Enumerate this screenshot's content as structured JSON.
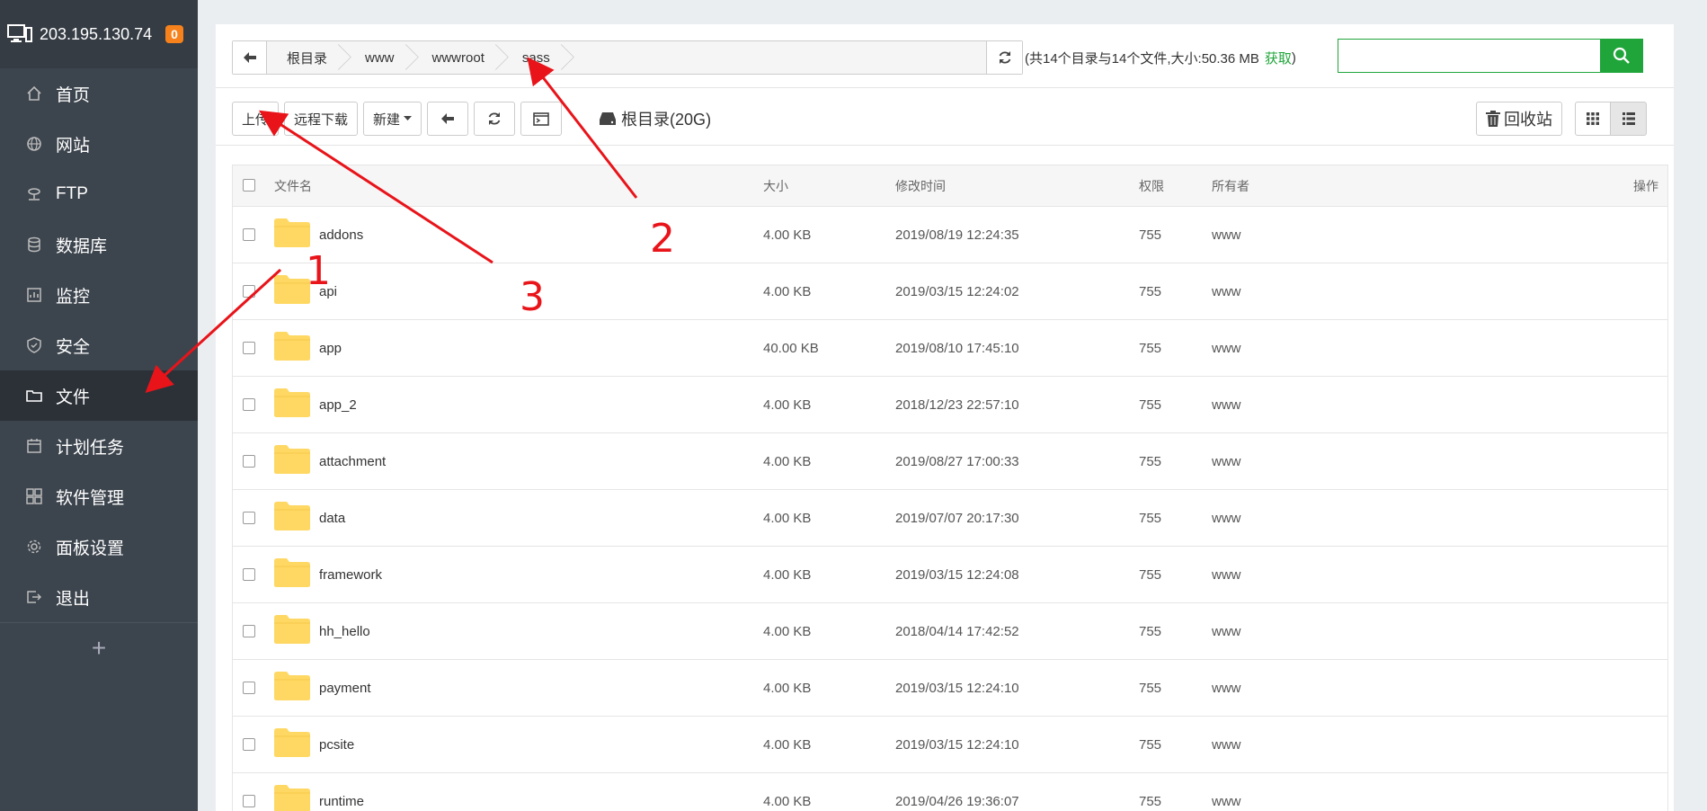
{
  "sidebar": {
    "ip": "203.195.130.74",
    "badge": "0",
    "items": [
      {
        "label": "首页",
        "icon": "home-icon"
      },
      {
        "label": "网站",
        "icon": "globe-icon"
      },
      {
        "label": "FTP",
        "icon": "ftp-icon"
      },
      {
        "label": "数据库",
        "icon": "database-icon"
      },
      {
        "label": "监控",
        "icon": "monitor-icon"
      },
      {
        "label": "安全",
        "icon": "shield-icon"
      },
      {
        "label": "文件",
        "icon": "folder-icon"
      },
      {
        "label": "计划任务",
        "icon": "calendar-icon"
      },
      {
        "label": "软件管理",
        "icon": "apps-icon"
      },
      {
        "label": "面板设置",
        "icon": "gear-icon"
      },
      {
        "label": "退出",
        "icon": "logout-icon"
      }
    ],
    "add": "+"
  },
  "pathbar": {
    "crumbs": [
      "根目录",
      "www",
      "wwwroot",
      "sass"
    ]
  },
  "summary": {
    "text": "(共14个目录与14个文件,大小:50.36 MB",
    "fetch": "获取",
    "close": ")"
  },
  "search": {
    "placeholder": ""
  },
  "toolbar": {
    "upload": "上传",
    "remote_download": "远程下载",
    "new": "新建",
    "disk": "根目录(20G)",
    "recycle": "回收站"
  },
  "table": {
    "headers": {
      "name": "文件名",
      "size": "大小",
      "time": "修改时间",
      "perm": "权限",
      "owner": "所有者",
      "ops": "操作"
    },
    "rows": [
      {
        "name": "addons",
        "size": "4.00 KB",
        "time": "2019/08/19 12:24:35",
        "perm": "755",
        "owner": "www"
      },
      {
        "name": "api",
        "size": "4.00 KB",
        "time": "2019/03/15 12:24:02",
        "perm": "755",
        "owner": "www"
      },
      {
        "name": "app",
        "size": "40.00 KB",
        "time": "2019/08/10 17:45:10",
        "perm": "755",
        "owner": "www"
      },
      {
        "name": "app_2",
        "size": "4.00 KB",
        "time": "2018/12/23 22:57:10",
        "perm": "755",
        "owner": "www"
      },
      {
        "name": "attachment",
        "size": "4.00 KB",
        "time": "2019/08/27 17:00:33",
        "perm": "755",
        "owner": "www"
      },
      {
        "name": "data",
        "size": "4.00 KB",
        "time": "2019/07/07 20:17:30",
        "perm": "755",
        "owner": "www"
      },
      {
        "name": "framework",
        "size": "4.00 KB",
        "time": "2019/03/15 12:24:08",
        "perm": "755",
        "owner": "www"
      },
      {
        "name": "hh_hello",
        "size": "4.00 KB",
        "time": "2018/04/14 17:42:52",
        "perm": "755",
        "owner": "www"
      },
      {
        "name": "payment",
        "size": "4.00 KB",
        "time": "2019/03/15 12:24:10",
        "perm": "755",
        "owner": "www"
      },
      {
        "name": "pcsite",
        "size": "4.00 KB",
        "time": "2019/03/15 12:24:10",
        "perm": "755",
        "owner": "www"
      },
      {
        "name": "runtime",
        "size": "4.00 KB",
        "time": "2019/04/26 19:36:07",
        "perm": "755",
        "owner": "www"
      }
    ]
  },
  "annotations": [
    "1",
    "2",
    "3"
  ],
  "colors": {
    "sidebar_bg": "#3c444d",
    "accent_green": "#20a53a",
    "annotation_red": "#e8141a",
    "folder_yellow": "#ffd863"
  }
}
